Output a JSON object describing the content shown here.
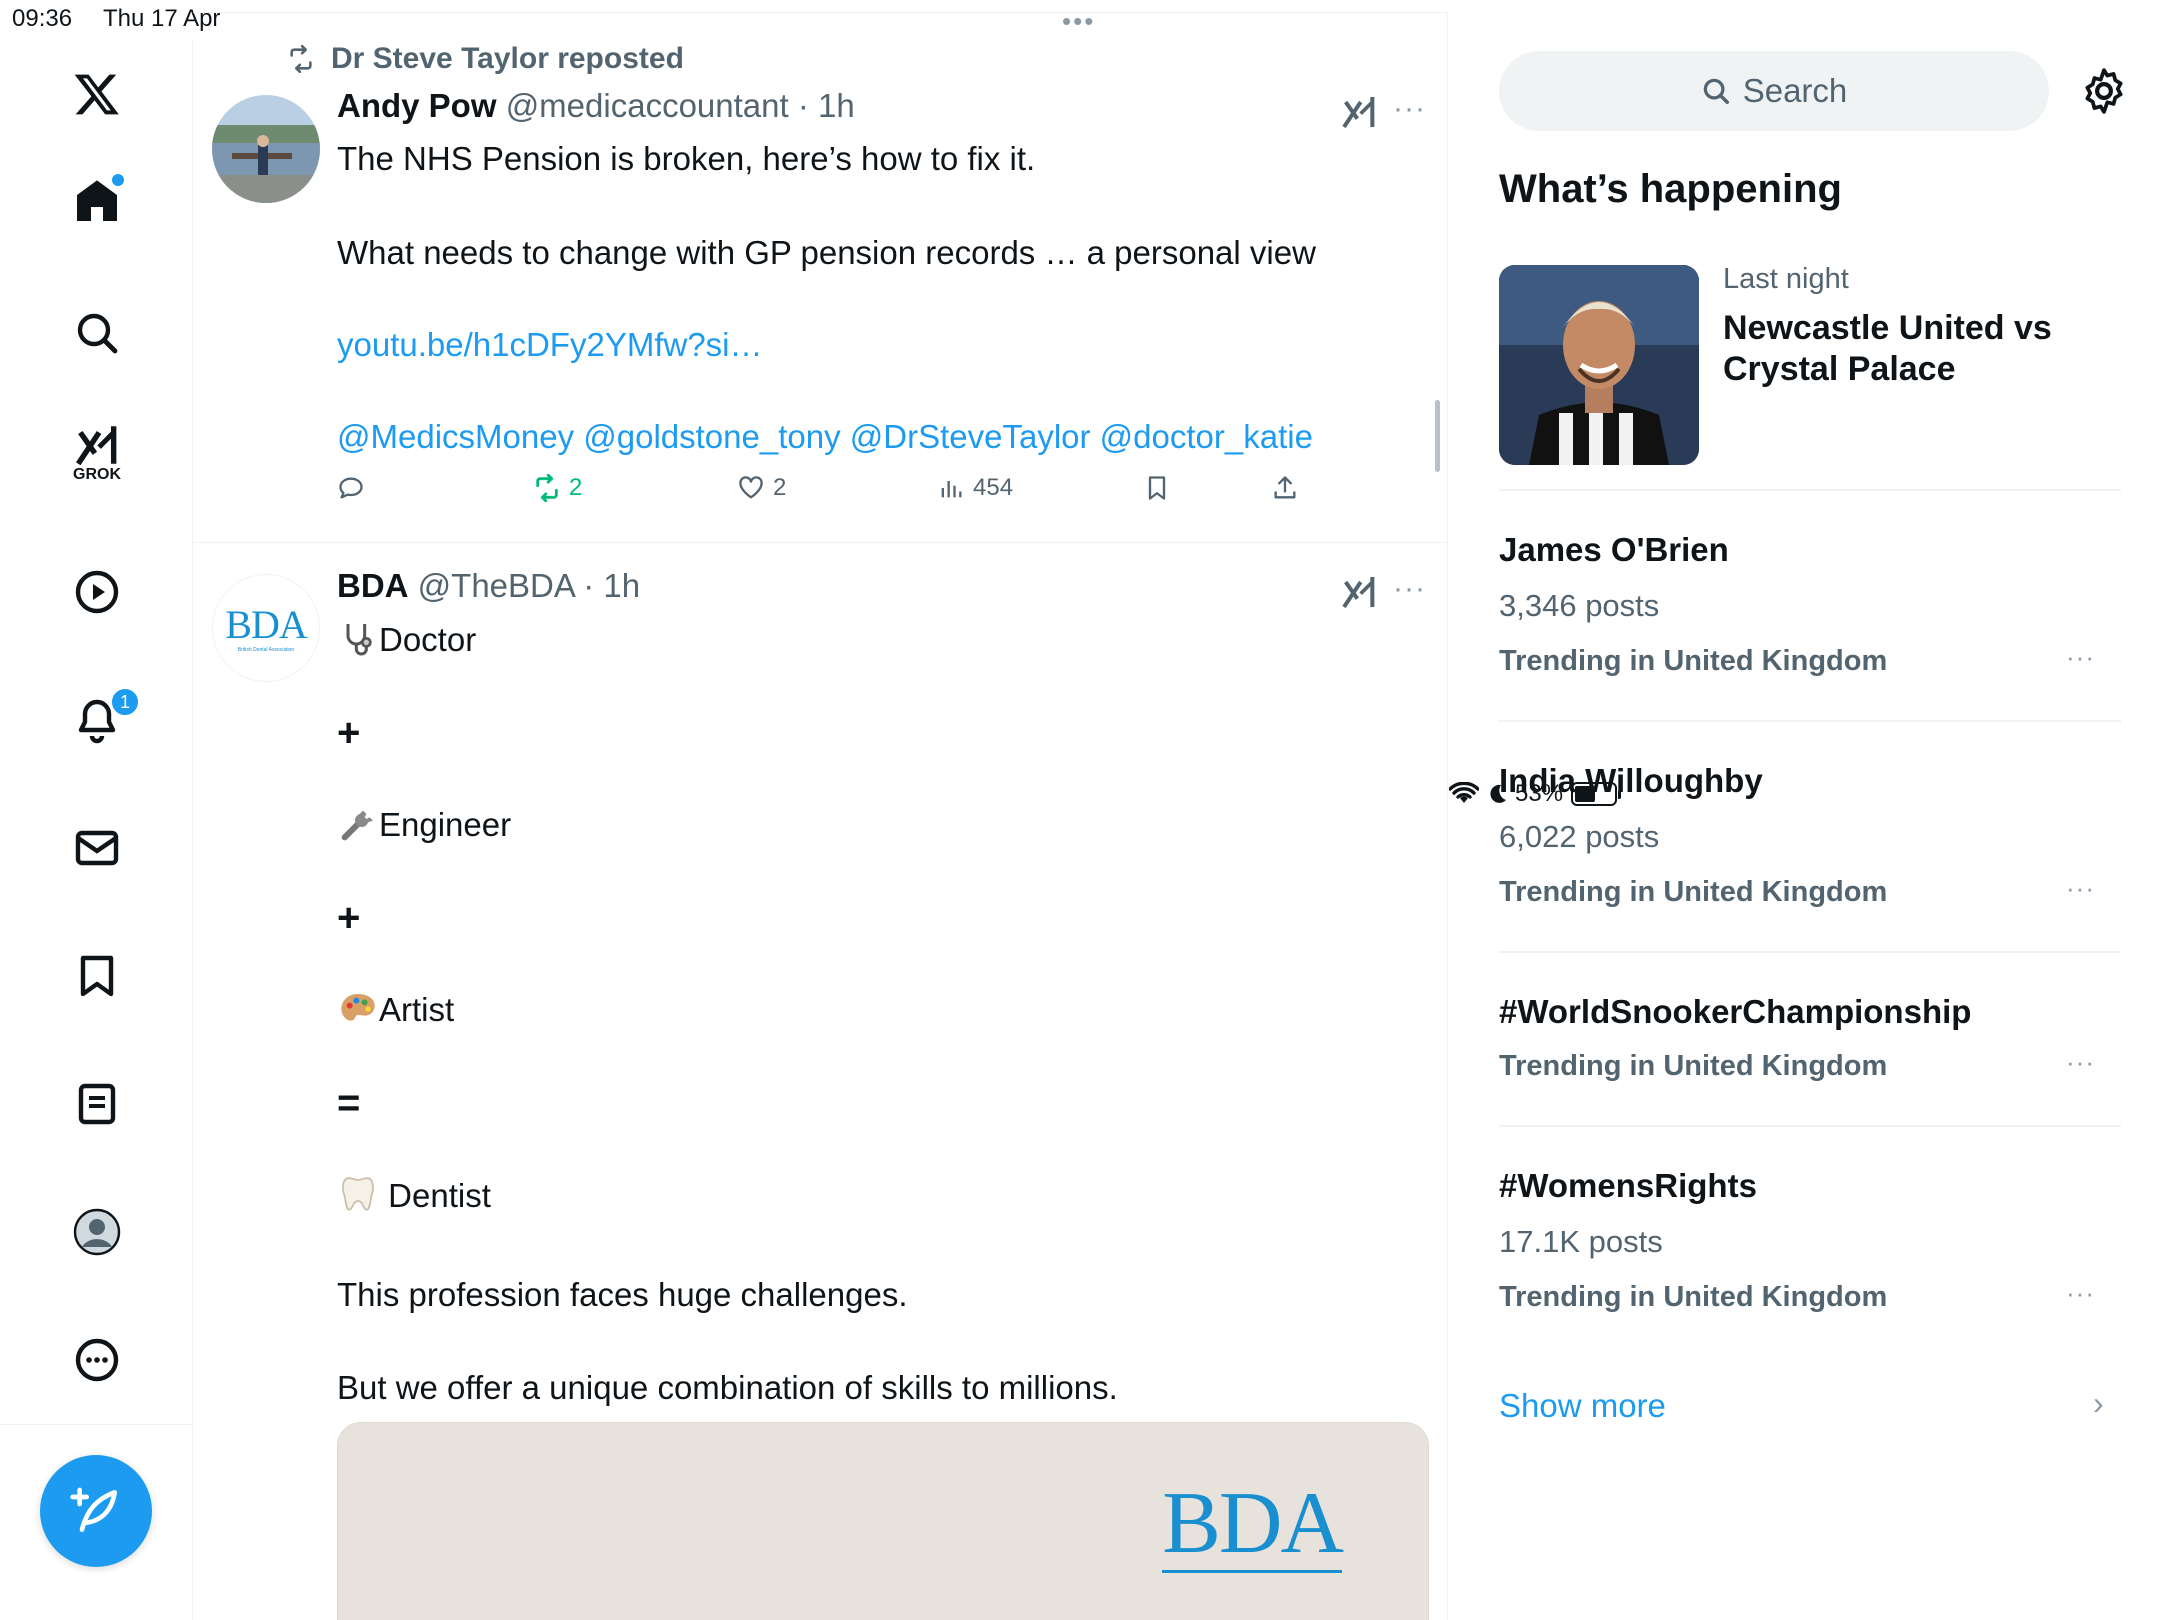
{
  "status_bar": {
    "time": "09:36",
    "date": "Thu 17 Apr",
    "battery": "53%",
    "battery_level": 0.53
  },
  "nav": {
    "items": [
      {
        "name": "home",
        "icon": "home-icon"
      },
      {
        "name": "explore",
        "icon": "search-icon"
      },
      {
        "name": "grok",
        "icon": "grok-icon",
        "label": "GROK"
      },
      {
        "name": "video",
        "icon": "play-icon"
      },
      {
        "name": "notifications",
        "icon": "bell-icon",
        "badge": "1"
      },
      {
        "name": "messages",
        "icon": "mail-icon"
      },
      {
        "name": "bookmarks",
        "icon": "bookmark-icon"
      },
      {
        "name": "lists",
        "icon": "list-icon"
      },
      {
        "name": "profile",
        "icon": "avatar-icon"
      },
      {
        "name": "more",
        "icon": "more-icon"
      }
    ],
    "grok_label": "GROK",
    "notification_badge": "1",
    "accent": "#1d9bf0"
  },
  "tweets": [
    {
      "repost_by": "Dr Steve Taylor reposted",
      "name": "Andy Pow",
      "handle": "@medicaccountant",
      "time": "· 1h",
      "lines": [
        "The NHS Pension is broken, here’s how to fix it.",
        "What needs to change with GP pension records … a personal view"
      ],
      "link": "youtu.be/h1cDFy2YMfw?si…",
      "mentions": "@MedicsMoney @goldstone_tony @DrSteveTaylor @doctor_katie",
      "retweets": "2",
      "likes": "2",
      "views": "454"
    },
    {
      "name": "BDA",
      "handle": "@TheBDA",
      "time": "· 1h",
      "avatar_text": "BDA",
      "avatar_subtext": "British Dental Association",
      "lines": [
        "Doctor",
        "+",
        "Engineer",
        "+",
        "Artist",
        "=",
        "Dentist",
        "This profession faces huge challenges.",
        "But we offer a unique combination of skills to millions."
      ],
      "media_logo": "BDA"
    }
  ],
  "sidebar": {
    "search_placeholder": "Search",
    "section_title": "What’s happening",
    "featured": {
      "when": "Last night",
      "title": "Newcastle United vs Crystal Palace"
    },
    "trends": [
      {
        "name": "James O'Brien",
        "count": "3,346 posts",
        "context": "Trending in United Kingdom"
      },
      {
        "name": "India Willoughby",
        "count": "6,022 posts",
        "context": "Trending in United Kingdom"
      },
      {
        "name": "#WorldSnookerChampionship",
        "count": "",
        "context": "Trending in United Kingdom"
      },
      {
        "name": "#WomensRights",
        "count": "17.1K posts",
        "context": "Trending in United Kingdom"
      }
    ],
    "show_more": "Show more"
  }
}
